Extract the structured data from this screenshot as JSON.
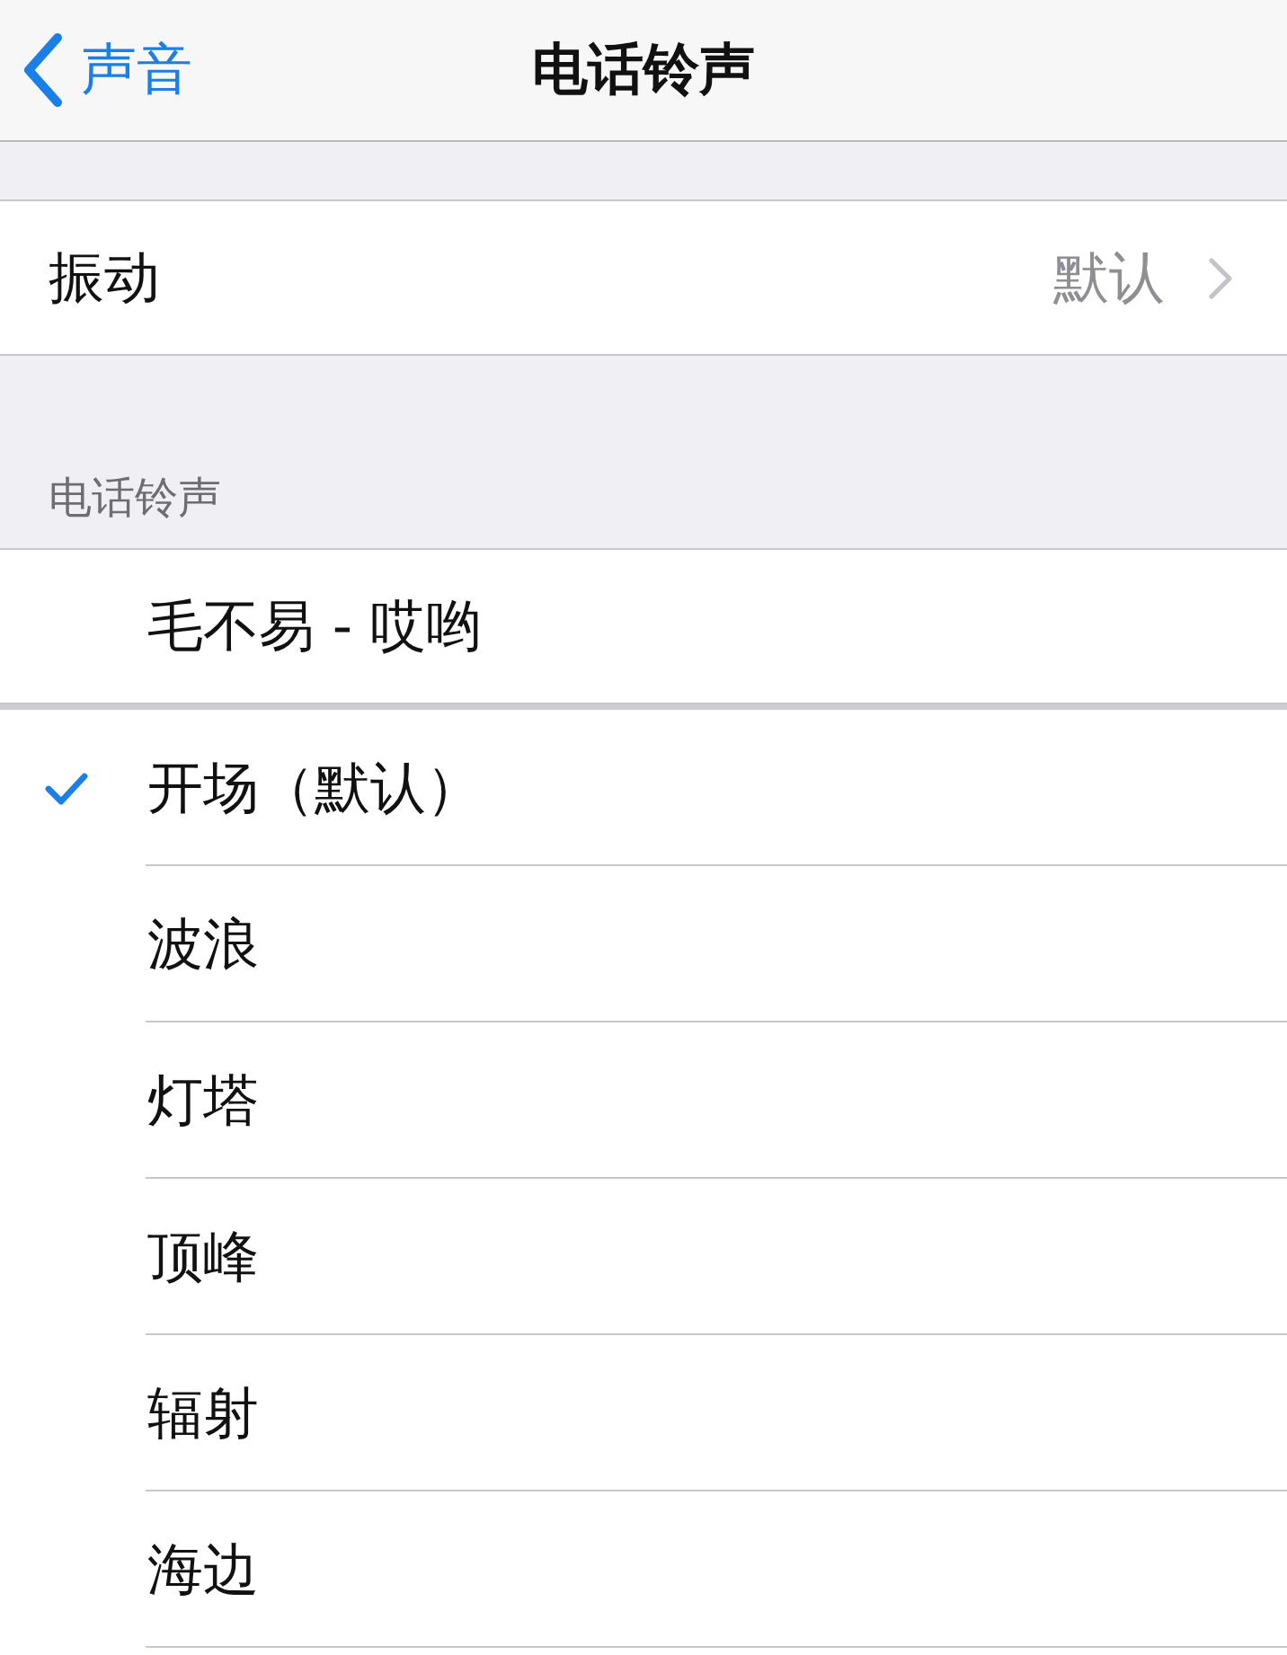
{
  "nav_bar": {
    "back_label": "声音",
    "title": "电话铃声"
  },
  "settings": [
    {
      "label": "振动",
      "value": "默认"
    }
  ],
  "ringtone_section": {
    "header": "电话铃声",
    "songs": [
      {
        "label": "毛不易 - 哎哟",
        "selected": false
      }
    ],
    "ringtones": [
      {
        "label": "开场（默认）",
        "selected": true
      },
      {
        "label": "波浪",
        "selected": false
      },
      {
        "label": "灯塔",
        "selected": false
      },
      {
        "label": "顶峰",
        "selected": false
      },
      {
        "label": "辐射",
        "selected": false
      },
      {
        "label": "海边",
        "selected": false
      }
    ]
  }
}
